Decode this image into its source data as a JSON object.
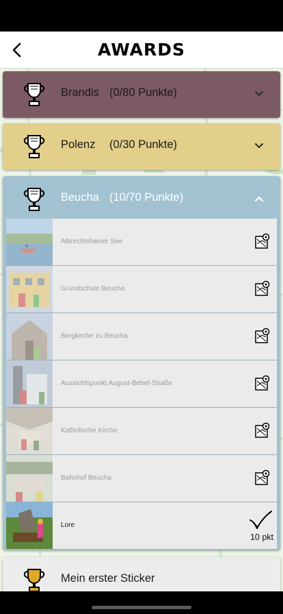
{
  "header": {
    "title": "AWARDS"
  },
  "groups": [
    {
      "name": "Brandis",
      "points": "(0/80 Punkte)"
    },
    {
      "name": "Polenz",
      "points": "(0/30 Punkte)"
    },
    {
      "name": "Beucha",
      "points": "(10/70 Punkte)"
    },
    {
      "name": "Mein erster Sticker"
    }
  ],
  "beucha_items": [
    {
      "label": "Albrechtshainer See"
    },
    {
      "label": "Grundschule Beucha"
    },
    {
      "label": "Bergkirche zu Beucha"
    },
    {
      "label": "Aussichtspunkt August-Bebel-Straße"
    },
    {
      "label": "Katholische Kirche"
    },
    {
      "label": "Bahnhof Beucha"
    },
    {
      "label": "Lore",
      "points": "10 pkt"
    }
  ],
  "colors": {
    "brandis": "#7c5a64",
    "polenz": "#e2cf8a",
    "beucha": "#a2c2d2",
    "item_bg": "#ebebeb"
  },
  "icons": {
    "back": "chevron-left-icon",
    "trophy": "trophy-icon",
    "collapse": "chevron-down-icon",
    "expand": "chevron-up-icon",
    "location": "map-location-icon",
    "done": "checkmark-icon"
  }
}
